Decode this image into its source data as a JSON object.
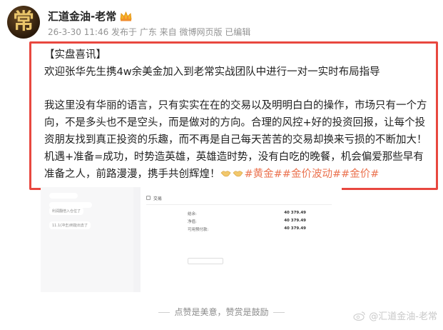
{
  "author": {
    "name": "汇道金油-老常",
    "avatar_char": "常",
    "badge_icon": "crown-icon",
    "meta": "26-3-30 11:46 发布于 广东 来自 微博网页版 已编辑"
  },
  "post": {
    "title": "【实盘喜讯】",
    "line1": "欢迎张华先生携4w余美金加入到老常实战团队中进行一对一实时布局指导",
    "body": "我这里没有华丽的语言，只有实实在在的交易以及明明白白的操作，市场只有一个方向，不是多头也不是空头，而是做对的方向。合理的风控+好的投资回报，让每个投资朋友找到真正投资的乐趣，而不再是自己每天苦苦的交易却换来亏损的不断加大！ 机遇+准备=成功，时势造英雄，英雄造时势，没有白吃的晚餐，机会偏爱那些早有准备之人，前路漫漫，携手共创辉煌！",
    "emoji": "handshake-icon",
    "hashtags": "#黄金##金价波动##金价#"
  },
  "screenshot": {
    "chat_bubbles": [
      "",
      "",
      "利润翻倍入仓位了",
      "11.1(冲击)到能出去了"
    ],
    "trade_title": "交易",
    "rows": [
      {
        "label": "结余:",
        "value": "40 379.49"
      },
      {
        "label": "净值:",
        "value": "40 379.49"
      },
      {
        "label": "可用预付款:",
        "value": "40 379.49"
      }
    ]
  },
  "footer": {
    "tip": "点赞是美意，赞赏是鼓励",
    "watermark": "@汇道金油-老常"
  },
  "colors": {
    "highlight_border": "#e8473f",
    "hashtag": "#eb7350",
    "meta_text": "#939393"
  }
}
